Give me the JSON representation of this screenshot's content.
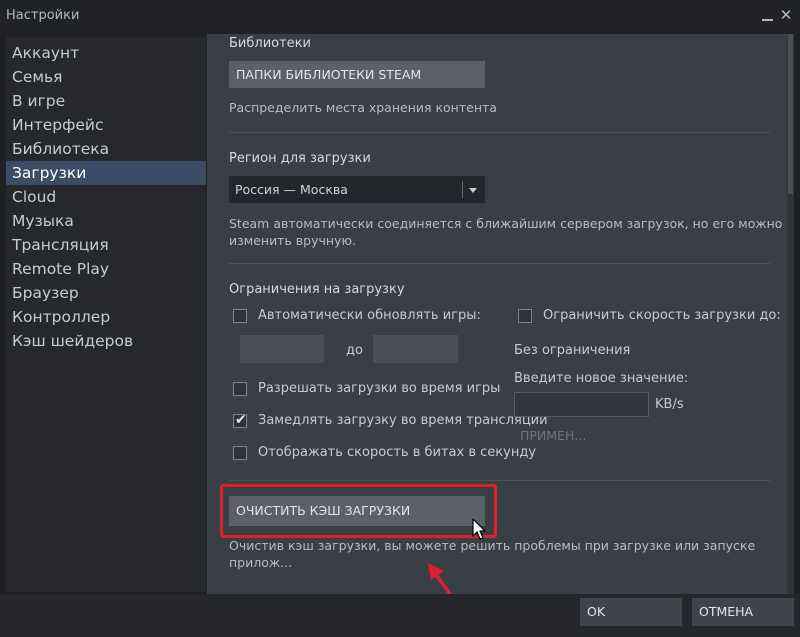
{
  "window": {
    "title": "Настройки"
  },
  "sidebar": {
    "items": [
      {
        "label": "Аккаунт"
      },
      {
        "label": "Семья"
      },
      {
        "label": "В игре"
      },
      {
        "label": "Интерфейс"
      },
      {
        "label": "Библиотека"
      },
      {
        "label": "Загрузки",
        "active": true
      },
      {
        "label": "Cloud"
      },
      {
        "label": "Музыка"
      },
      {
        "label": "Трансляция"
      },
      {
        "label": "Remote Play"
      },
      {
        "label": "Браузер"
      },
      {
        "label": "Контроллер"
      },
      {
        "label": "Кэш шейдеров"
      }
    ]
  },
  "libraries": {
    "heading": "Библиотеки",
    "button": "ПАПКИ БИБЛИОТЕКИ STEAM",
    "description": "Распределить места хранения контента"
  },
  "region": {
    "heading": "Регион для загрузки",
    "selected": "Россия — Москва",
    "description_line1": "Steam автоматически соединяется с ближайшим сервером загрузок, но его можно",
    "description_line2": "изменить вручную."
  },
  "limits": {
    "heading": "Ограничения на загрузку",
    "auto_update": {
      "label": "Автоматически обновлять игры:",
      "checked": false
    },
    "time_separator": "до",
    "allow_while_playing": {
      "label": "Разрешать загрузки во время игры",
      "checked": false
    },
    "throttle_broadcast": {
      "label": "Замедлять загрузку во время трансляции",
      "checked": true
    },
    "show_bits": {
      "label": "Отображать скорость в битах в секунду",
      "checked": false
    },
    "limit_speed": {
      "label": "Ограничить скорость загрузки до:",
      "checked": false
    },
    "no_limit": "Без ограничения",
    "new_value_label": "Введите новое значение:",
    "unit": "KB/s",
    "apply": "ПРИМЕН..."
  },
  "cache": {
    "button": "ОЧИСТИТЬ КЭШ ЗАГРУЗКИ",
    "description": "Очистив кэш загрузки, вы можете решить проблемы при загрузке или запуске прилож..."
  },
  "footer": {
    "ok": "OK",
    "cancel": "ОТМЕНА"
  },
  "colors": {
    "highlight": "#e01f2b",
    "active_item": "#3b4c67"
  }
}
